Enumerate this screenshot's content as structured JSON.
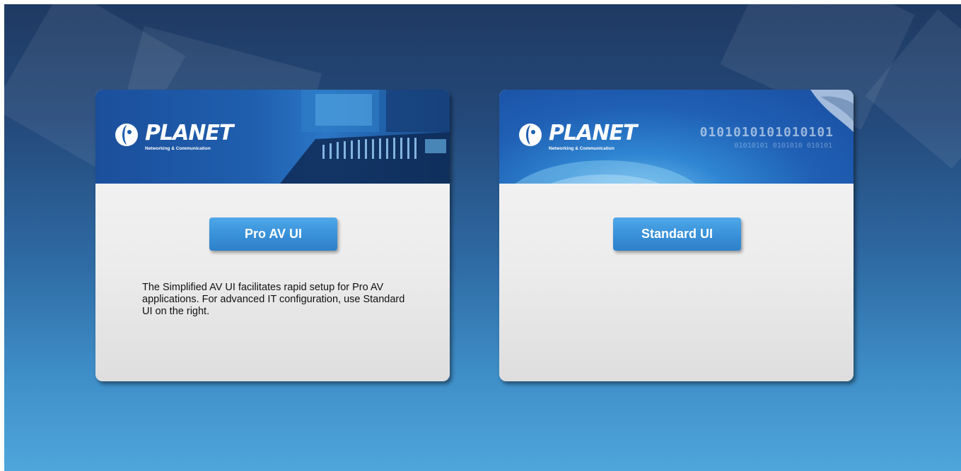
{
  "brand": {
    "name": "PLANET",
    "tagline": "Networking & Communication"
  },
  "cards": [
    {
      "button_label": "Pro AV UI",
      "description": "The Simplified AV UI facilitates rapid setup for Pro AV applications. For advanced IT configuration, use Standard UI on the right."
    },
    {
      "button_label": "Standard UI"
    }
  ],
  "colors": {
    "background_top": "#1f3a63",
    "background_bottom": "#4ea6db",
    "button": "#3a92da",
    "card": "#ececec"
  },
  "icons": [
    "planet-logo-icon",
    "audio-mixer-image",
    "globe-binary-image"
  ]
}
